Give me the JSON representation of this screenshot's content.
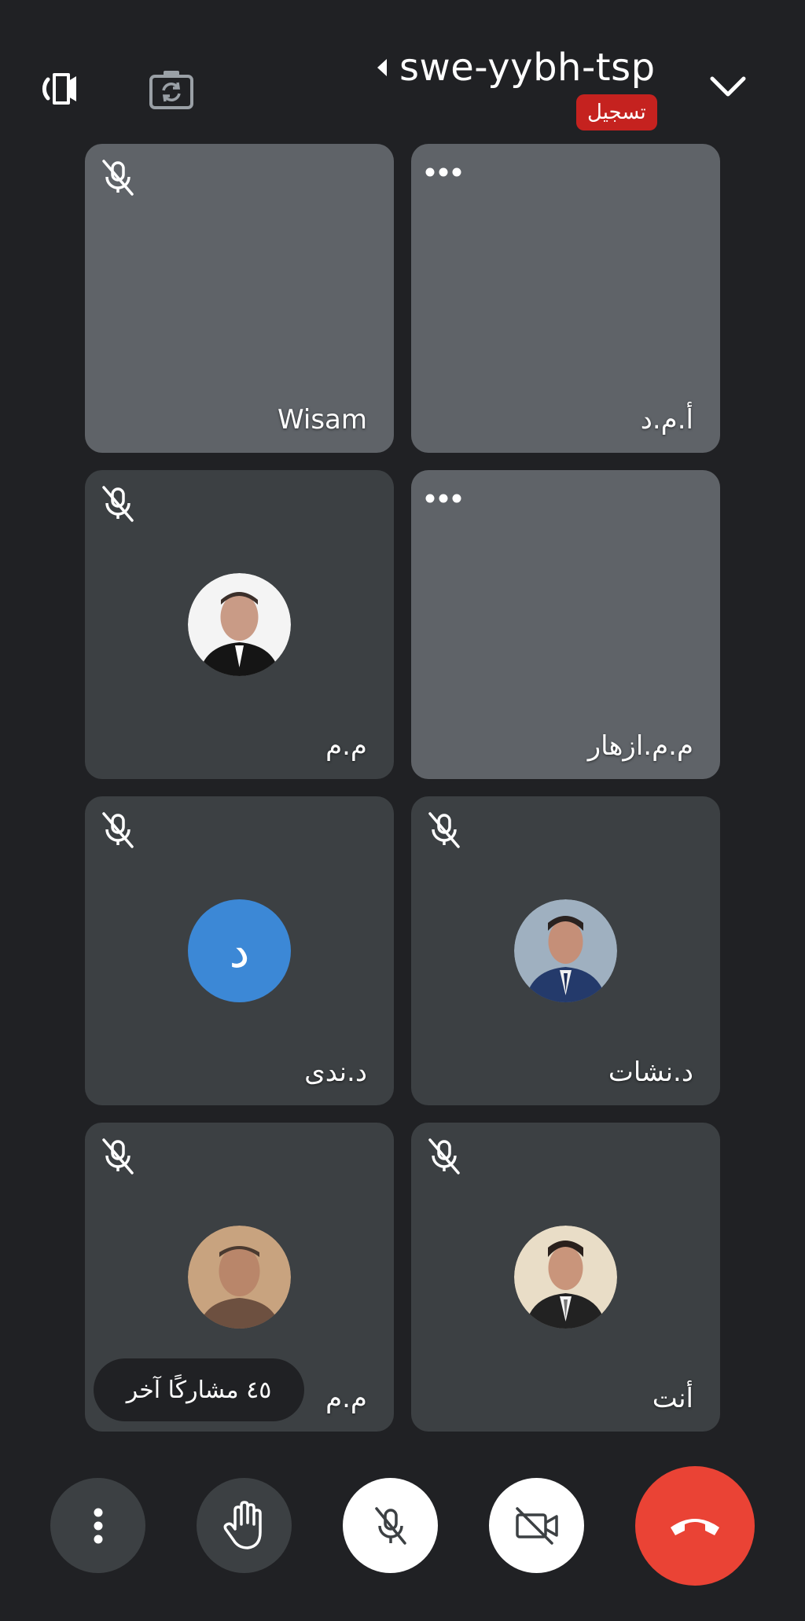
{
  "header": {
    "meeting_code": "swe-yybh-tsp",
    "recording_label": "تسجيل"
  },
  "participants": [
    {
      "name": "Wisam",
      "muted": true,
      "has_video": true
    },
    {
      "name": "أ.م.د",
      "muted": false,
      "has_video": true
    },
    {
      "name": "م.م",
      "muted": true,
      "has_video": false
    },
    {
      "name": "م.م.ازهار",
      "muted": false,
      "has_video": true
    },
    {
      "name": "د.ندى",
      "muted": true,
      "has_video": false,
      "avatar_letter": "د"
    },
    {
      "name": "د.نشات",
      "muted": true,
      "has_video": false
    },
    {
      "name": "م.م",
      "muted": true,
      "has_video": false
    },
    {
      "name": "أنت",
      "muted": true,
      "has_video": false
    }
  ],
  "others_count_label": "٤٥ مشاركًا آخر",
  "controls": {
    "more": "more-vert-icon",
    "raise_hand": "raise-hand-icon",
    "mic": "mic-off-icon",
    "camera": "videocam-off-icon",
    "end_call": "call-end-icon"
  },
  "colors": {
    "background": "#202124",
    "tile": "#3c4043",
    "recording": "#c5221f",
    "end_call": "#ea4335",
    "letter_avatar": "#3c88d6"
  }
}
